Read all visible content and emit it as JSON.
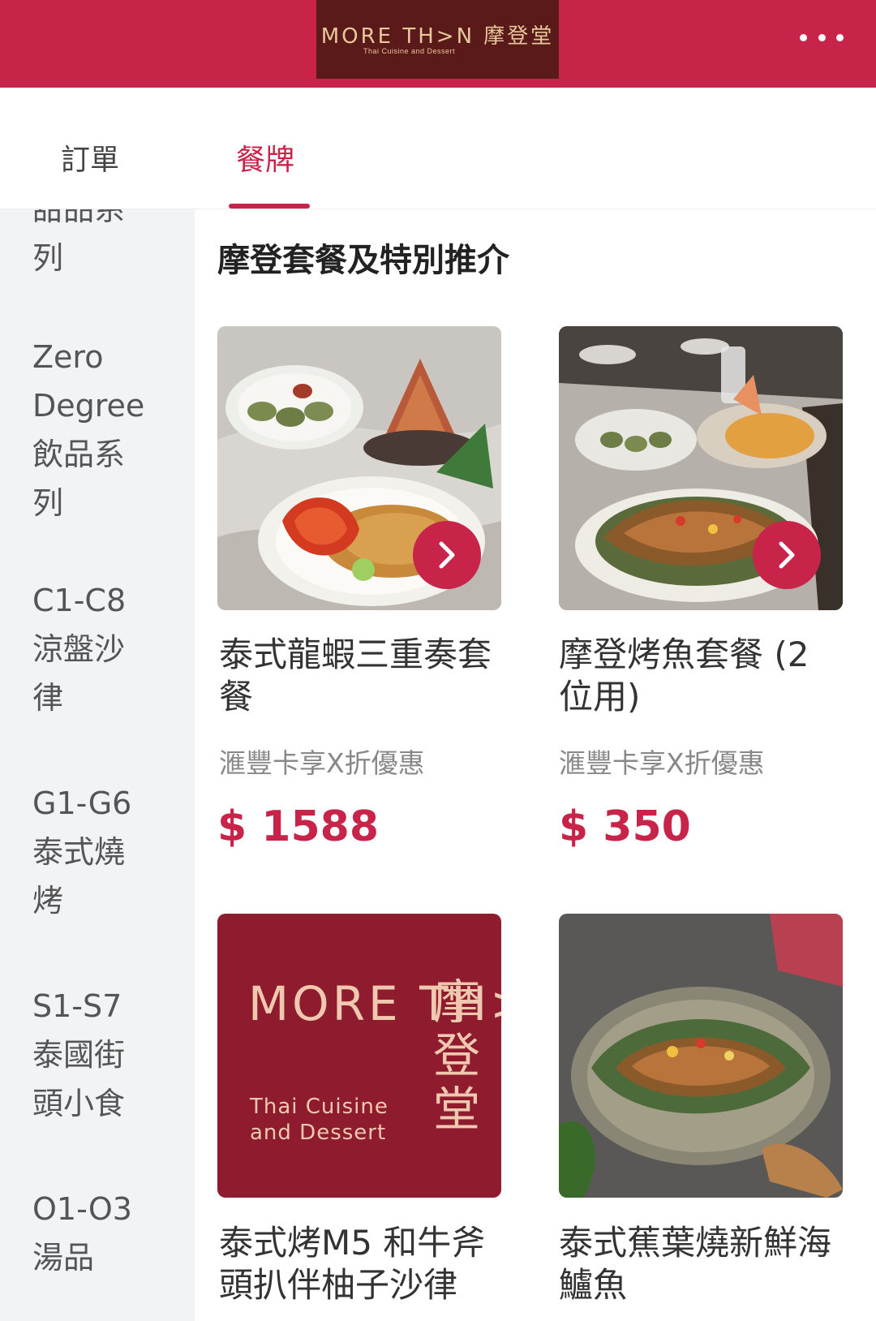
{
  "header": {
    "logo_main": "MORE TH>N 摩登堂",
    "logo_sub": "Thai Cuisine and Dessert"
  },
  "tabs": {
    "orders": "訂單",
    "menu": "餐牌"
  },
  "sidebar": {
    "items": [
      {
        "label": "甜品系列"
      },
      {
        "label": "Zero Degree 飲品系列"
      },
      {
        "label": "C1-C8 涼盤沙律"
      },
      {
        "label": "G1-G6 泰式燒烤"
      },
      {
        "label": "S1-S7 泰國街頭小食"
      },
      {
        "label": "O1-O3 湯品"
      }
    ]
  },
  "section": {
    "title": "摩登套餐及特別推介"
  },
  "products": [
    {
      "name": "泰式龍蝦三重奏套餐",
      "promo": "滙豐卡享X折優惠",
      "price": "$ 1588"
    },
    {
      "name": "摩登烤魚套餐 (2位用)",
      "promo": "滙豐卡享X折優惠",
      "price": "$ 350"
    },
    {
      "name": "泰式烤M5 和牛斧頭扒伴柚子沙律",
      "logo_main": "MORE TH>N",
      "logo_cjk": "摩登堂",
      "logo_sub": "Thai Cuisine and Dessert"
    },
    {
      "name": "泰式蕉葉燒新鮮海鱸魚"
    }
  ],
  "colors": {
    "brand": "#c8244a",
    "logo_bg": "#5a1a1a",
    "logo_text": "#e8c89a",
    "sidebar_bg": "#f2f3f5"
  },
  "icons": [
    "more-dots-icon",
    "chevron-right-icon"
  ]
}
